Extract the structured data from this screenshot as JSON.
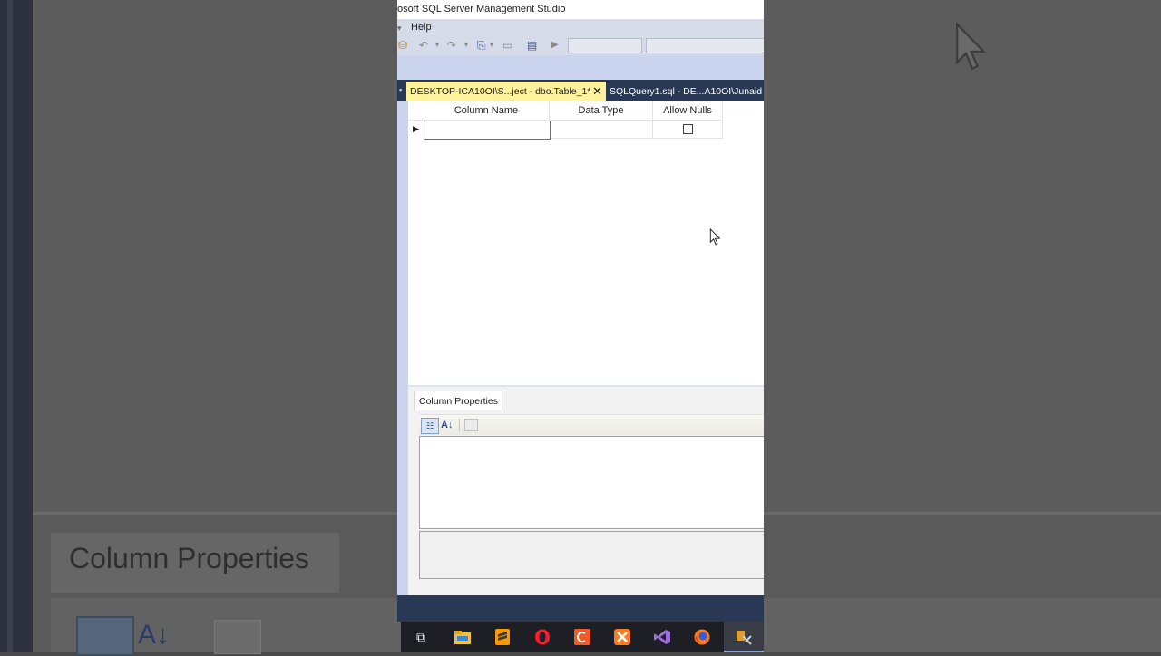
{
  "window": {
    "title": "osoft SQL Server Management Studio"
  },
  "menu": {
    "help": "Help"
  },
  "tabs": [
    {
      "label": "DESKTOP-ICA10OI\\S...ject - dbo.Table_1*",
      "active": true
    },
    {
      "label": "SQLQuery1.sql - DE...A10OI\\Junaid (",
      "active": false
    }
  ],
  "designer": {
    "columns": [
      "Column Name",
      "Data Type",
      "Allow Nulls"
    ],
    "rows": [
      {
        "name": "",
        "type": "",
        "allow_nulls": false
      }
    ]
  },
  "column_properties": {
    "tab_label": "Column Properties"
  },
  "background_zoom": {
    "label": "Column Properties"
  },
  "taskbar": {
    "icons": [
      "task-view-icon",
      "file-explorer-icon",
      "sublime-text-icon",
      "opera-icon",
      "app-orange-icon",
      "xampp-icon",
      "visual-studio-icon",
      "firefox-icon",
      "ssms-icon"
    ]
  },
  "colors": {
    "active_tab": "#fff29d",
    "tab_strip": "#293955",
    "window_chrome": "#ccd5f0"
  }
}
